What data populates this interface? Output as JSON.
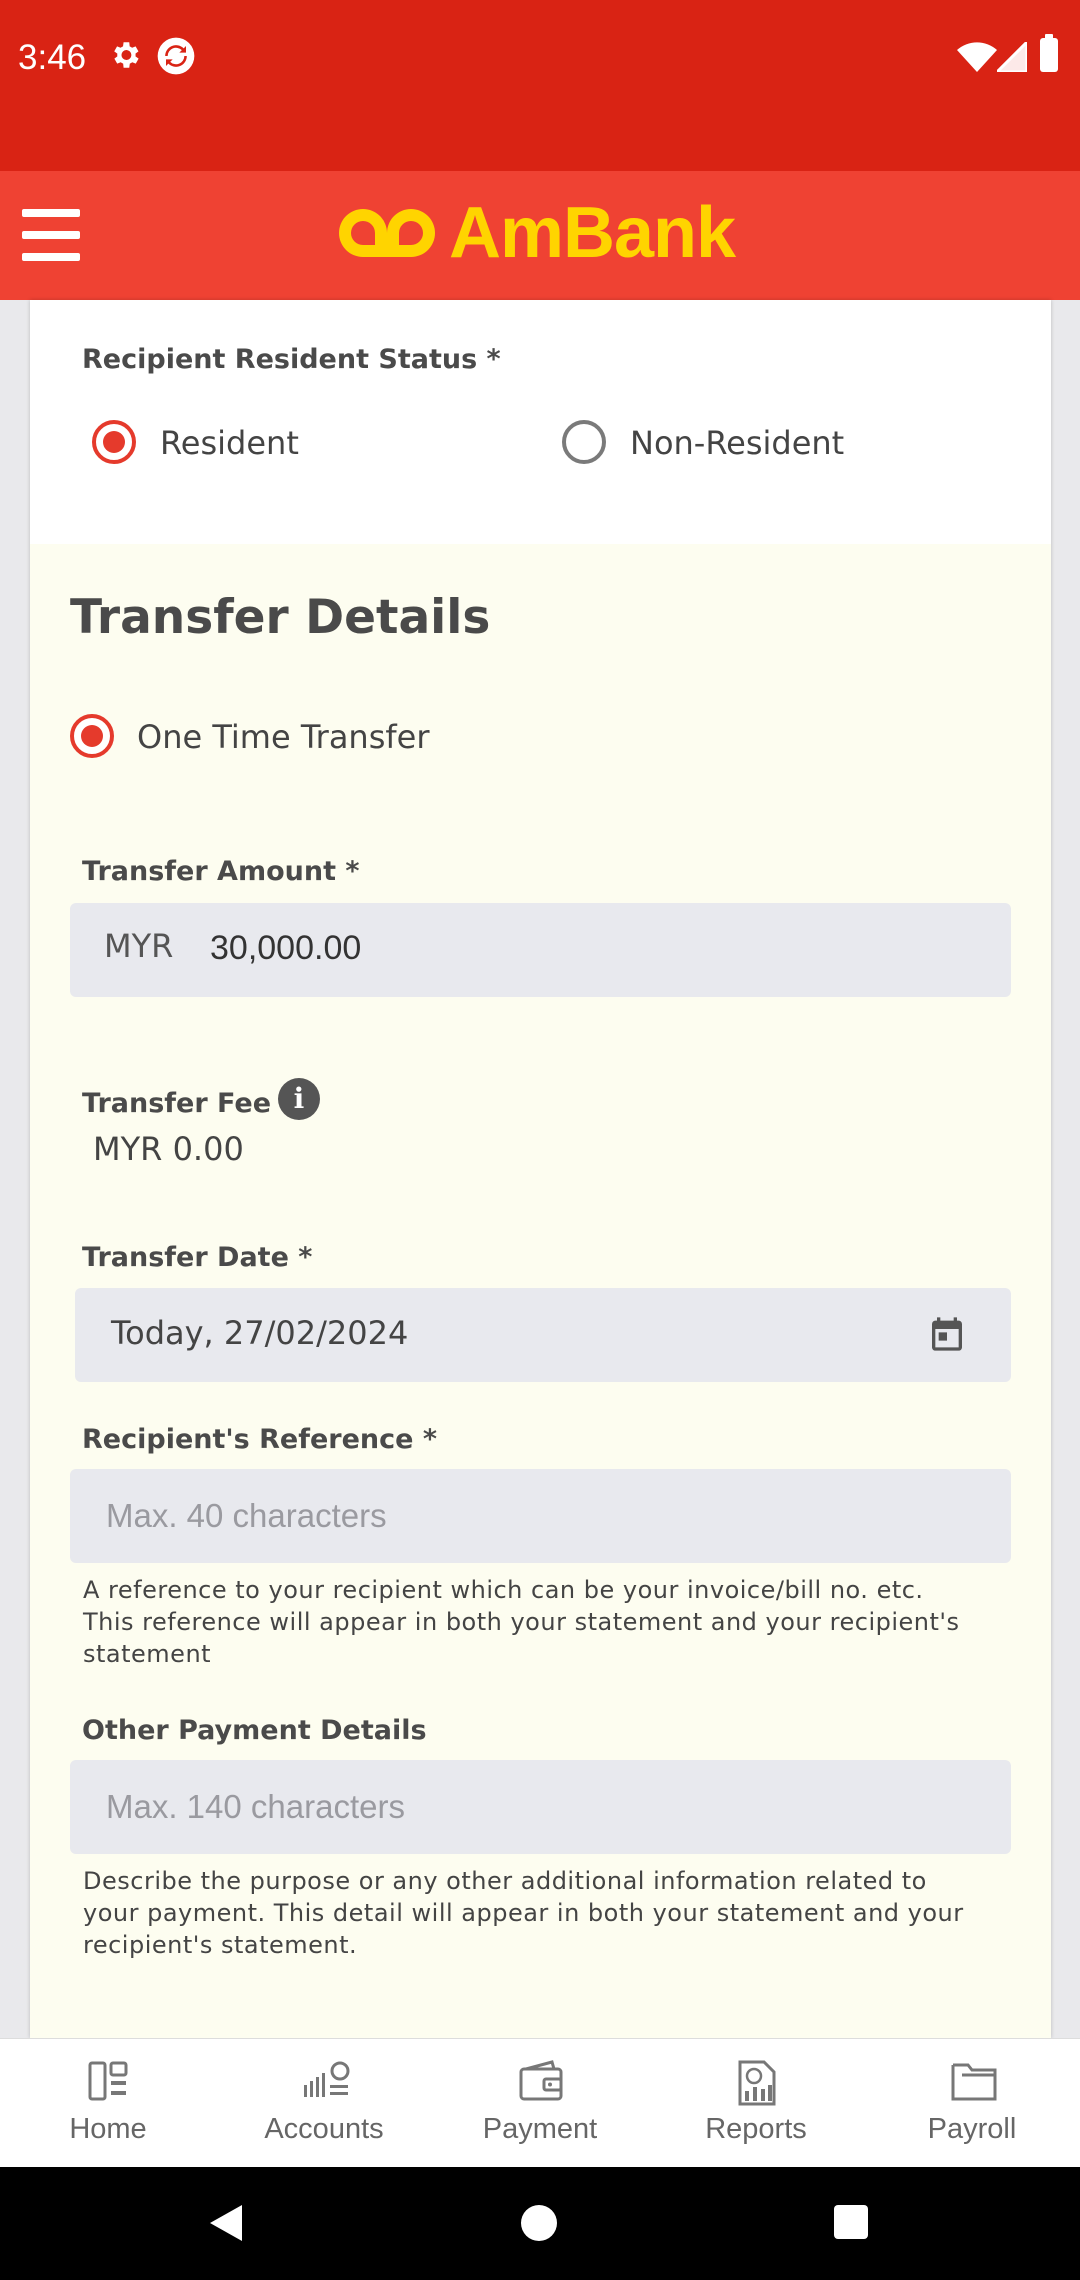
{
  "status_bar": {
    "time": "3:46",
    "icons": [
      "gear-icon",
      "sync-icon",
      "wifi-icon",
      "signal-icon",
      "battery-icon"
    ]
  },
  "app_bar": {
    "brand": "AmBank",
    "brand_color": "#ffd400",
    "bar_color": "#ef4233"
  },
  "resident_status": {
    "label": "Recipient Resident Status *",
    "options": [
      {
        "label": "Resident",
        "selected": true
      },
      {
        "label": "Non-Resident",
        "selected": false
      }
    ]
  },
  "transfer_details": {
    "title": "Transfer Details",
    "transfer_type": {
      "label": "One Time Transfer",
      "selected": true
    },
    "amount": {
      "label": "Transfer Amount *",
      "currency": "MYR",
      "value": "30,000.00"
    },
    "fee": {
      "label": "Transfer Fee",
      "value": "MYR 0.00"
    },
    "date": {
      "label": "Transfer Date *",
      "value": "Today, 27/02/2024"
    },
    "reference": {
      "label": "Recipient's Reference *",
      "placeholder": "Max. 40 characters",
      "help_lines": [
        "A reference to your recipient which can be your invoice/bill no. etc.",
        "This reference will appear in both your statement and your recipient's",
        "statement"
      ]
    },
    "other_details": {
      "label": "Other Payment Details",
      "placeholder": "Max. 140 characters",
      "help_lines": [
        "Describe the purpose or any other additional information related to",
        "your payment. This detail will appear in both your statement and your",
        "recipient's statement."
      ]
    }
  },
  "bottom_nav": [
    {
      "label": "Home",
      "icon": "home-icon"
    },
    {
      "label": "Accounts",
      "icon": "accounts-icon"
    },
    {
      "label": "Payment",
      "icon": "wallet-icon"
    },
    {
      "label": "Reports",
      "icon": "reports-icon"
    },
    {
      "label": "Payroll",
      "icon": "folder-icon"
    }
  ],
  "accent_color": "#e53a2c"
}
